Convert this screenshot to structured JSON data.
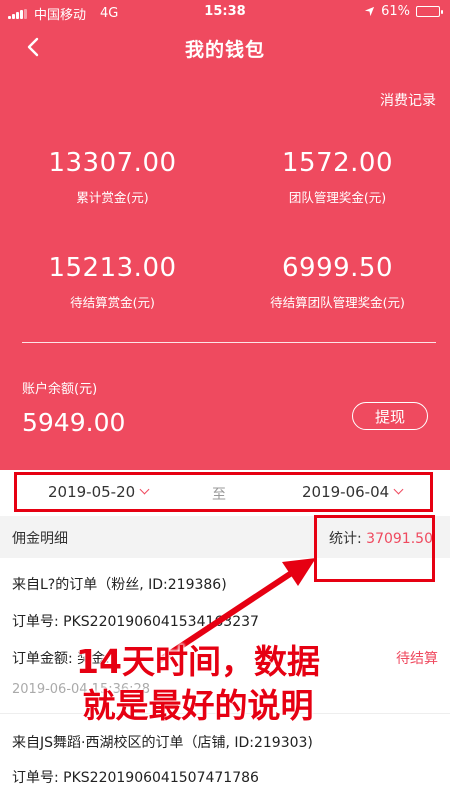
{
  "statusbar": {
    "carrier": "中国移动",
    "network": "4G",
    "time": "15:38",
    "battery": "61%",
    "battery_level": 0.61
  },
  "nav": {
    "title": "我的钱包",
    "back_icon": "chevron-left-icon"
  },
  "wallet": {
    "records_label": "消费记录",
    "stats": [
      {
        "value": "13307.00",
        "label": "累计赏金(元)"
      },
      {
        "value": "1572.00",
        "label": "团队管理奖金(元)"
      },
      {
        "value": "15213.00",
        "label": "待结算赏金(元)"
      },
      {
        "value": "6999.50",
        "label": "待结算团队管理奖金(元)"
      }
    ],
    "balance_label": "账户余额(元)",
    "balance_value": "5949.00",
    "withdraw_label": "提现"
  },
  "filter": {
    "start_date": "2019-05-20",
    "to_label": "至",
    "end_date": "2019-06-04"
  },
  "detail": {
    "title": "佣金明细",
    "total_label": "统计:",
    "total_value": "37091.50"
  },
  "orders": [
    {
      "source": "来自L?的订单（粉丝, ID:219386)",
      "order_no": "订单号:   PKS2201906041534163237",
      "amount": "订单金额:          奖金:",
      "time": "2019-06-04 15:36:28",
      "status": "待结算"
    },
    {
      "source": "来自JS舞蹈·西湖校区的订单（店铺, ID:219303)",
      "order_no": "订单号:   PKS2201906041507471786"
    }
  ],
  "annotation": {
    "line1": "14天时间，数据",
    "line2": "就是最好的说明",
    "color": "#e60012"
  },
  "colors": {
    "brand": "#ef4a5f",
    "accent_text": "#ef4a5f"
  }
}
